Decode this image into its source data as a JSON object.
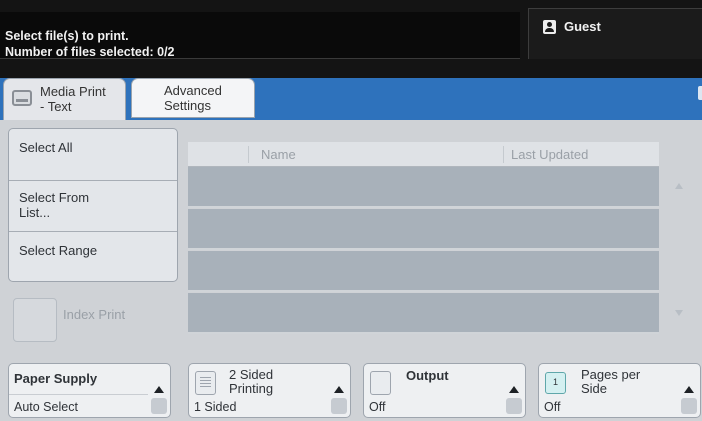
{
  "header": {
    "status_line1": "Select file(s) to print.",
    "status_line2": "Number of files selected: 0/2",
    "user_label": "Guest"
  },
  "tabs": [
    {
      "line1": "Media Print",
      "line2": "- Text",
      "active": true
    },
    {
      "line1": "Advanced",
      "line2": "Settings",
      "active": false
    }
  ],
  "select_buttons": {
    "select_all": "Select All",
    "select_from_list_line1": "Select From",
    "select_from_list_line2": "List...",
    "select_range": "Select Range"
  },
  "index_print": {
    "label": "Index Print",
    "enabled": false
  },
  "file_list": {
    "columns": [
      "Name",
      "Last Updated"
    ],
    "rows": [],
    "visible_row_slots": 4
  },
  "features": {
    "paper_supply": {
      "title": "Paper Supply",
      "value": "Auto Select"
    },
    "two_sided": {
      "title_line1": "2 Sided",
      "title_line2": "Printing",
      "value": "1 Sided"
    },
    "output": {
      "title": "Output",
      "value": "Off"
    },
    "pages_per_side": {
      "title_line1": "Pages per",
      "title_line2": "Side",
      "value": "Off",
      "icon_number": "1"
    }
  },
  "colors": {
    "header_bg": "#141414",
    "tab_bar": "#2e72bc",
    "list_row": "#a8b1ba",
    "panel_bg": "#cfd2d6"
  }
}
